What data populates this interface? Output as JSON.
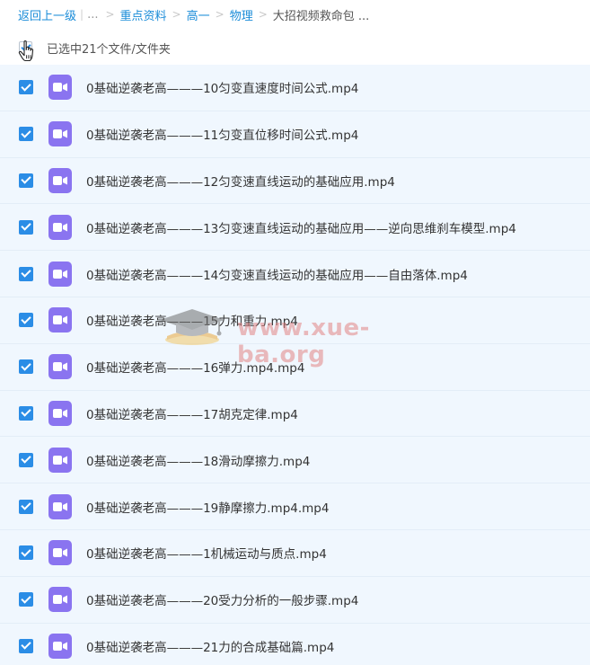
{
  "breadcrumb": {
    "back": "返回上一级",
    "ellipsis": "...",
    "items": [
      "重点资料",
      "高一",
      "物理"
    ],
    "current": "大招视频救命包 ..."
  },
  "selection": {
    "text": "已选中21个文件/文件夹"
  },
  "files": [
    "0基础逆袭老高———10匀变直速度时间公式.mp4",
    "0基础逆袭老高———11匀变直位移时间公式.mp4",
    "0基础逆袭老高———12匀变速直线运动的基础应用.mp4",
    "0基础逆袭老高———13匀变速直线运动的基础应用——逆向思维刹车模型.mp4",
    "0基础逆袭老高———14匀变速直线运动的基础应用——自由落体.mp4",
    "0基础逆袭老高———15力和重力.mp4",
    "0基础逆袭老高———16弹力.mp4.mp4",
    "0基础逆袭老高———17胡克定律.mp4",
    "0基础逆袭老高———18滑动摩擦力.mp4",
    "0基础逆袭老高———19静摩擦力.mp4.mp4",
    "0基础逆袭老高———1机械运动与质点.mp4",
    "0基础逆袭老高———20受力分析的一般步骤.mp4",
    "0基础逆袭老高———21力的合成基础篇.mp4"
  ],
  "watermark": {
    "text": "www.xue-ba.org"
  },
  "colors": {
    "link": "#1a8cd8",
    "row_bg": "#f0f7fe",
    "checkbox": "#2b8de6",
    "video_icon": "#8a74f0"
  }
}
